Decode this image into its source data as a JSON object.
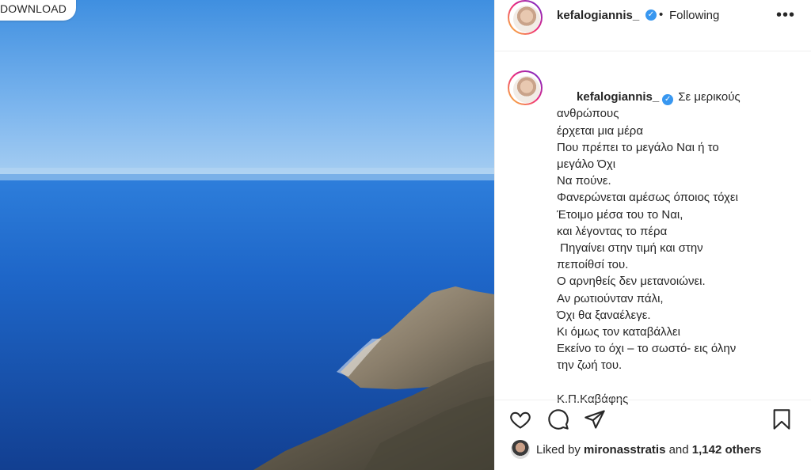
{
  "photo": {
    "download_label": "DOWNLOAD",
    "colors": {
      "sky_top": "#3f8fe0",
      "sky_haze": "#a9cff2",
      "sea": "#1e66c8",
      "sea_deep": "#0f3f8c",
      "cliff": "#8a7e6e"
    }
  },
  "post": {
    "username": "kefalogiannis_",
    "follow_status": "Following",
    "dot_separator": "•",
    "more_icon_label": "•••",
    "verified_mark": "✓",
    "caption_lines": [
      "Σε μερικούς",
      "ανθρώπους",
      "έρχεται μια μέρα",
      "Που πρέπει το μεγάλο Ναι ή το",
      "μεγάλο Όχι",
      "Να πούνε.",
      "Φανερώνεται αμέσως όποιος τόχει",
      "Έτοιμο μέσα του το Ναι,",
      "και λέγοντας το πέρα",
      " Πηγαίνει στην τιμή και στην",
      "πεποίθσί του.",
      "Ο αρνηθείς δεν μετανοιώνει.",
      "Αν ρωτιούνταν πάλι,",
      "Όχι θα ξαναέλεγε.",
      "Κι όμως τον καταβάλλει",
      "Εκείνο το όχι – το σωστό- εις όλην",
      "την ζωή του.",
      "",
      "Κ.Π.Καβάφης"
    ],
    "likes": {
      "prefix": "Liked by",
      "user": "mironasstratis",
      "joiner": "and",
      "others": "1,142 others"
    }
  },
  "icons": {
    "like": "heart-icon",
    "comment": "comment-icon",
    "share": "share-icon",
    "save": "bookmark-icon"
  },
  "accent": {
    "verified": "#3897f0",
    "text": "#262626",
    "divider": "#efefef"
  }
}
